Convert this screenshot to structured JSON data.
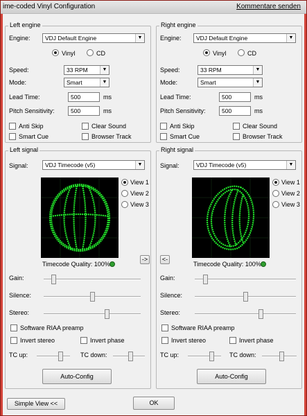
{
  "window": {
    "title": "ime-coded Vinyl Configuration",
    "feedback_link": "Kommentare senden"
  },
  "left_engine": {
    "legend": "Left engine",
    "engine_label": "Engine:",
    "engine_value": "VDJ Default Engine",
    "vinyl_label": "Vinyl",
    "cd_label": "CD",
    "selected_medium": "Vinyl",
    "speed_label": "Speed:",
    "speed_value": "33 RPM",
    "mode_label": "Mode:",
    "mode_value": "Smart",
    "lead_time_label": "Lead Time:",
    "lead_time_value": "500",
    "lead_time_unit": "ms",
    "pitch_label": "Pitch Sensitivity:",
    "pitch_value": "500",
    "pitch_unit": "ms",
    "anti_skip": "Anti Skip",
    "clear_sound": "Clear Sound",
    "smart_cue": "Smart Cue",
    "browser_track": "Browser Track"
  },
  "right_engine": {
    "legend": "Right engine",
    "engine_label": "Engine:",
    "engine_value": "VDJ Default Engine",
    "vinyl_label": "Vinyl",
    "cd_label": "CD",
    "selected_medium": "Vinyl",
    "speed_label": "Speed:",
    "speed_value": "33 RPM",
    "mode_label": "Mode:",
    "mode_value": "Smart",
    "lead_time_label": "Lead Time:",
    "lead_time_value": "500",
    "lead_time_unit": "ms",
    "pitch_label": "Pitch Sensitivity:",
    "pitch_value": "500",
    "pitch_unit": "ms",
    "anti_skip": "Anti Skip",
    "clear_sound": "Clear Sound",
    "smart_cue": "Smart Cue",
    "browser_track": "Browser Track"
  },
  "left_signal": {
    "legend": "Left signal",
    "signal_label": "Signal:",
    "signal_value": "VDJ Timecode (v5)",
    "views": [
      "View 1",
      "View 2",
      "View 3"
    ],
    "selected_view": "View 1",
    "quality_label": "Timecode Quality: 100%",
    "copy_button": "->",
    "gain_label": "Gain:",
    "gain_level": 0.1,
    "silence_label": "Silence:",
    "silence_level": 0.5,
    "stereo_label": "Stereo:",
    "stereo_level": 0.65,
    "riaa": "Software RIAA preamp",
    "invert_stereo": "Invert stereo",
    "invert_phase": "Invert phase",
    "tc_up_label": "TC up:",
    "tc_up_level": 0.7,
    "tc_down_label": "TC down:",
    "tc_down_level": 0.55,
    "auto_config": "Auto-Config"
  },
  "right_signal": {
    "legend": "Right signal",
    "signal_label": "Signal:",
    "signal_value": "VDJ Timecode (v5)",
    "views": [
      "View 1",
      "View 2",
      "View 3"
    ],
    "selected_view": "View 1",
    "quality_label": "Timecode Quality: 100%",
    "copy_button": "<-",
    "gain_label": "Gain:",
    "gain_level": 0.1,
    "silence_label": "Silence:",
    "silence_level": 0.5,
    "stereo_label": "Stereo:",
    "stereo_level": 0.65,
    "riaa": "Software RIAA preamp",
    "invert_stereo": "Invert stereo",
    "invert_phase": "Invert phase",
    "tc_up_label": "TC up:",
    "tc_up_level": 0.7,
    "tc_down_label": "TC down:",
    "tc_down_level": 0.55,
    "auto_config": "Auto-Config"
  },
  "footer": {
    "simple_view": "Simple View <<",
    "ok": "OK"
  },
  "colors": {
    "scope_trace": "#22e62a",
    "window_border": "#c4372f"
  }
}
